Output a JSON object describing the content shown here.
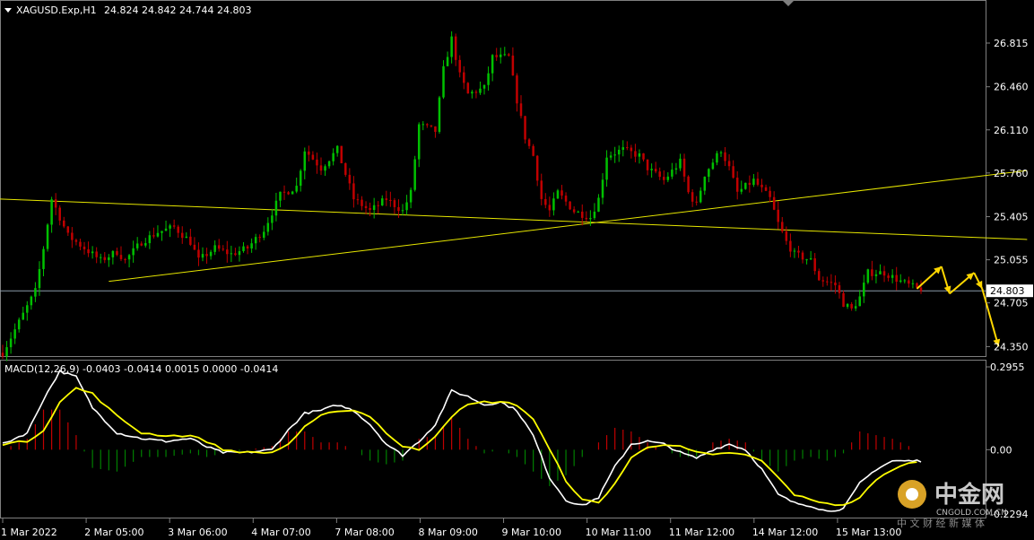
{
  "window": {
    "symbol": "XAGUSD.Exp,H1",
    "ohlc": "24.824 24.842 24.744 24.803",
    "macd_label": "MACD(12,26,9) -0.0403 -0.0414 0.0015 0.0000 -0.0414"
  },
  "colors": {
    "background": "#000000",
    "bull": "#00c000",
    "bear": "#c00000",
    "trendline": "#e6e600",
    "arrow": "#ffd700",
    "macd_main": "#ffffff",
    "macd_signal": "#ffff00",
    "hist_pos": "#c00000",
    "hist_neg": "#008000",
    "price_line": "#8a9aa8"
  },
  "chart_data": [
    {
      "type": "candlestick",
      "name": "XAGUSD.Exp,H1",
      "y_ticks": [
        "26.815",
        "26.460",
        "26.110",
        "25.760",
        "25.405",
        "25.055",
        "24.705",
        "24.350"
      ],
      "ylim": [
        24.28,
        27.15
      ],
      "current_price": "24.803",
      "x_ticks": [
        "1 Mar 2022",
        "2 Mar 05:00",
        "3 Mar 06:00",
        "4 Mar 07:00",
        "7 Mar 08:00",
        "8 Mar 09:00",
        "9 Mar 10:00",
        "10 Mar 11:00",
        "11 Mar 12:00",
        "14 Mar 12:00",
        "15 Mar 13:00"
      ],
      "close_path": [
        [
          0,
          24.3
        ],
        [
          4,
          24.55
        ],
        [
          8,
          24.8
        ],
        [
          10,
          25.15
        ],
        [
          12,
          25.55
        ],
        [
          14,
          25.4
        ],
        [
          16,
          25.25
        ],
        [
          20,
          25.15
        ],
        [
          24,
          25.05
        ],
        [
          28,
          25.12
        ],
        [
          30,
          25.05
        ],
        [
          34,
          25.2
        ],
        [
          38,
          25.28
        ],
        [
          42,
          25.32
        ],
        [
          46,
          25.2
        ],
        [
          48,
          25.05
        ],
        [
          52,
          25.15
        ],
        [
          56,
          25.1
        ],
        [
          60,
          25.15
        ],
        [
          64,
          25.3
        ],
        [
          68,
          25.58
        ],
        [
          72,
          25.65
        ],
        [
          74,
          25.95
        ],
        [
          78,
          25.8
        ],
        [
          82,
          25.95
        ],
        [
          84,
          25.75
        ],
        [
          86,
          25.55
        ],
        [
          90,
          25.45
        ],
        [
          94,
          25.55
        ],
        [
          98,
          25.45
        ],
        [
          100,
          25.6
        ],
        [
          102,
          26.15
        ],
        [
          106,
          26.1
        ],
        [
          108,
          26.6
        ],
        [
          110,
          26.85
        ],
        [
          112,
          26.55
        ],
        [
          114,
          26.4
        ],
        [
          118,
          26.45
        ],
        [
          120,
          26.7
        ],
        [
          124,
          26.7
        ],
        [
          126,
          26.35
        ],
        [
          128,
          26.05
        ],
        [
          130,
          25.9
        ],
        [
          132,
          25.55
        ],
        [
          134,
          25.45
        ],
        [
          136,
          25.6
        ],
        [
          140,
          25.45
        ],
        [
          144,
          25.4
        ],
        [
          146,
          25.55
        ],
        [
          148,
          25.9
        ],
        [
          152,
          25.95
        ],
        [
          156,
          25.9
        ],
        [
          158,
          25.8
        ],
        [
          162,
          25.7
        ],
        [
          166,
          25.85
        ],
        [
          168,
          25.6
        ],
        [
          170,
          25.5
        ],
        [
          172,
          25.75
        ],
        [
          176,
          25.95
        ],
        [
          178,
          25.8
        ],
        [
          180,
          25.6
        ],
        [
          184,
          25.7
        ],
        [
          188,
          25.55
        ],
        [
          190,
          25.35
        ],
        [
          192,
          25.2
        ],
        [
          194,
          25.1
        ],
        [
          198,
          25.05
        ],
        [
          200,
          24.9
        ],
        [
          204,
          24.85
        ],
        [
          206,
          24.7
        ],
        [
          208,
          24.65
        ],
        [
          210,
          24.75
        ],
        [
          212,
          24.95
        ],
        [
          216,
          24.95
        ],
        [
          220,
          24.88
        ],
        [
          224,
          24.82
        ]
      ],
      "bars_total": 226,
      "forecast_path": [
        [
          224,
          24.82
        ],
        [
          230,
          25.0
        ],
        [
          232,
          24.78
        ],
        [
          238,
          24.95
        ],
        [
          240,
          24.82
        ],
        [
          244,
          24.35
        ]
      ],
      "trendlines": [
        {
          "from": [
            -2,
            25.55
          ],
          "to": [
            251,
            25.22
          ]
        },
        {
          "from": [
            26,
            24.88
          ],
          "to": [
            251,
            25.78
          ]
        }
      ]
    },
    {
      "type": "macd",
      "name": "MACD(12,26,9)",
      "params": [
        12,
        26,
        9
      ],
      "values": {
        "main": -0.0403,
        "signal": -0.0414,
        "osma": 0.0015,
        "level": 0.0,
        "last": -0.0414
      },
      "y_ticks": [
        "0.2955",
        "0.00",
        "-0.2294"
      ],
      "ylim": [
        -0.2294,
        0.2955
      ],
      "main_path": [
        [
          0,
          0.02
        ],
        [
          6,
          0.06
        ],
        [
          10,
          0.18
        ],
        [
          14,
          0.28
        ],
        [
          18,
          0.26
        ],
        [
          22,
          0.15
        ],
        [
          28,
          0.06
        ],
        [
          34,
          0.04
        ],
        [
          40,
          0.03
        ],
        [
          46,
          0.04
        ],
        [
          50,
          0.01
        ],
        [
          54,
          -0.01
        ],
        [
          60,
          -0.01
        ],
        [
          66,
          0.0
        ],
        [
          70,
          0.07
        ],
        [
          74,
          0.13
        ],
        [
          78,
          0.14
        ],
        [
          82,
          0.16
        ],
        [
          86,
          0.14
        ],
        [
          90,
          0.09
        ],
        [
          94,
          0.02
        ],
        [
          98,
          -0.02
        ],
        [
          102,
          0.03
        ],
        [
          106,
          0.09
        ],
        [
          110,
          0.21
        ],
        [
          114,
          0.19
        ],
        [
          118,
          0.16
        ],
        [
          122,
          0.17
        ],
        [
          126,
          0.14
        ],
        [
          130,
          0.05
        ],
        [
          134,
          -0.1
        ],
        [
          138,
          -0.18
        ],
        [
          142,
          -0.2
        ],
        [
          146,
          -0.17
        ],
        [
          150,
          -0.06
        ],
        [
          154,
          0.02
        ],
        [
          158,
          0.03
        ],
        [
          162,
          0.02
        ],
        [
          166,
          -0.01
        ],
        [
          170,
          -0.03
        ],
        [
          174,
          0.0
        ],
        [
          178,
          0.02
        ],
        [
          182,
          0.0
        ],
        [
          186,
          -0.07
        ],
        [
          190,
          -0.16
        ],
        [
          194,
          -0.19
        ],
        [
          198,
          -0.2
        ],
        [
          202,
          -0.22
        ],
        [
          206,
          -0.21
        ],
        [
          210,
          -0.12
        ],
        [
          214,
          -0.07
        ],
        [
          218,
          -0.04
        ],
        [
          224,
          -0.04
        ]
      ],
      "signal_path": [
        [
          0,
          0.02
        ],
        [
          6,
          0.03
        ],
        [
          10,
          0.07
        ],
        [
          14,
          0.17
        ],
        [
          18,
          0.22
        ],
        [
          22,
          0.2
        ],
        [
          28,
          0.12
        ],
        [
          34,
          0.06
        ],
        [
          40,
          0.05
        ],
        [
          46,
          0.05
        ],
        [
          50,
          0.03
        ],
        [
          54,
          0.0
        ],
        [
          60,
          -0.01
        ],
        [
          66,
          -0.01
        ],
        [
          70,
          0.02
        ],
        [
          74,
          0.08
        ],
        [
          78,
          0.12
        ],
        [
          82,
          0.14
        ],
        [
          86,
          0.14
        ],
        [
          90,
          0.12
        ],
        [
          94,
          0.06
        ],
        [
          98,
          0.01
        ],
        [
          102,
          0.0
        ],
        [
          106,
          0.05
        ],
        [
          110,
          0.12
        ],
        [
          114,
          0.16
        ],
        [
          118,
          0.17
        ],
        [
          122,
          0.17
        ],
        [
          126,
          0.16
        ],
        [
          130,
          0.11
        ],
        [
          134,
          0.0
        ],
        [
          138,
          -0.11
        ],
        [
          142,
          -0.18
        ],
        [
          146,
          -0.19
        ],
        [
          150,
          -0.12
        ],
        [
          154,
          -0.03
        ],
        [
          158,
          0.01
        ],
        [
          162,
          0.02
        ],
        [
          166,
          0.01
        ],
        [
          170,
          -0.01
        ],
        [
          174,
          -0.02
        ],
        [
          178,
          -0.01
        ],
        [
          182,
          -0.02
        ],
        [
          186,
          -0.04
        ],
        [
          190,
          -0.1
        ],
        [
          194,
          -0.16
        ],
        [
          198,
          -0.18
        ],
        [
          202,
          -0.19
        ],
        [
          206,
          -0.2
        ],
        [
          210,
          -0.17
        ],
        [
          214,
          -0.11
        ],
        [
          218,
          -0.07
        ],
        [
          224,
          -0.04
        ]
      ]
    }
  ],
  "watermark": {
    "brand": "中金网",
    "domain": "CNGOLD.COM.CN",
    "tagline": "中 文 财 经 新 媒 体"
  }
}
